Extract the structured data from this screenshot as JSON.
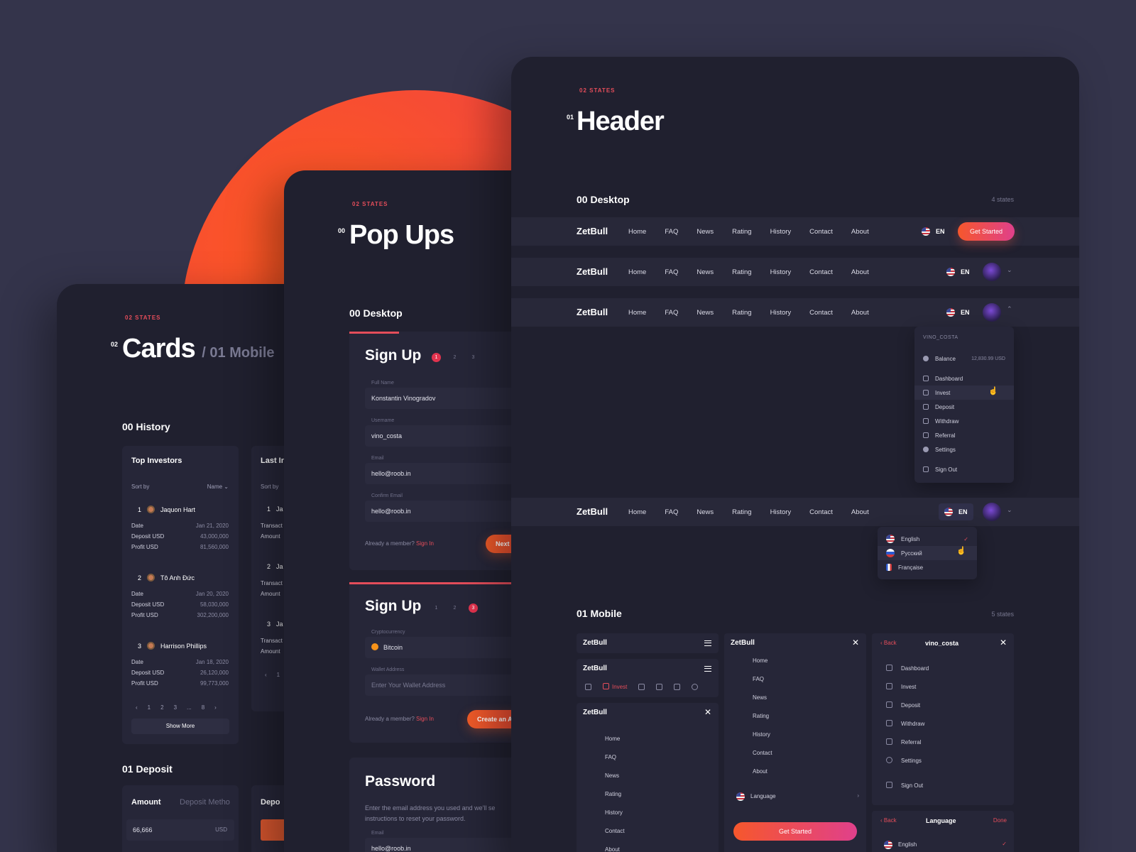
{
  "colors": {
    "background": "#34344b",
    "panel": "#20202f",
    "accent": "#e44d5a",
    "orange": "#f6572c",
    "pink": "#e0408b"
  },
  "cards_panel": {
    "states": "02 STATES",
    "num": "02",
    "title": "Cards",
    "subtitle": "/ 01 Mobile",
    "history_heading": "00 History",
    "top_investors": {
      "title": "Top Investors",
      "sort_label": "Sort by",
      "sort_value": "Name",
      "investors": [
        {
          "rank": "1",
          "name": "Jaquon Hart",
          "date": "Jan 21, 2020",
          "deposit": "43,000,000",
          "profit": "81,560,000"
        },
        {
          "rank": "2",
          "name": "Tô Anh Đức",
          "date": "Jan 20, 2020",
          "deposit": "58,030,000",
          "profit": "302,200,000"
        },
        {
          "rank": "3",
          "name": "Harrison Phillips",
          "date": "Jan 18, 2020",
          "deposit": "26,120,000",
          "profit": "99,773,000"
        }
      ],
      "labels": {
        "date": "Date",
        "deposit": "Deposit USD",
        "profit": "Profit USD"
      },
      "pagination": [
        "‹",
        "1",
        "2",
        "3",
        "...",
        "8",
        "›"
      ],
      "show_more": "Show More"
    },
    "last_card": {
      "title": "Last In",
      "sort_label": "Sort by",
      "rows": [
        {
          "rank": "1",
          "name": "Ja",
          "l1": "Transact",
          "l2": "Amount"
        },
        {
          "rank": "2",
          "name": "Ja",
          "l1": "Transact",
          "l2": "Amount"
        },
        {
          "rank": "3",
          "name": "Ja",
          "l1": "Transact",
          "l2": "Amount"
        }
      ],
      "pag": [
        "‹",
        "1"
      ]
    },
    "deposit_heading": "01 Deposit",
    "deposit_card": {
      "amount_label": "Amount",
      "method_label": "Deposit Metho",
      "amount_value": "66,666",
      "currency": "USD"
    },
    "deposit_card2": {
      "title": "Depo"
    }
  },
  "popups_panel": {
    "states": "02 STATES",
    "num": "00",
    "title": "Pop Ups",
    "desktop_heading": "00 Desktop",
    "signup1": {
      "title": "Sign Up",
      "steps": [
        "1",
        "2",
        "3"
      ],
      "fields": [
        {
          "label": "Full Name",
          "value": "Konstantin Vinogradov"
        },
        {
          "label": "Username",
          "value": "vino_costa"
        },
        {
          "label": "Email",
          "value": "hello@roob.in"
        },
        {
          "label": "Confirm Email",
          "value": "hello@roob.in"
        }
      ],
      "already": "Already a member?",
      "signin": "Sign In",
      "next": "Next"
    },
    "signup3": {
      "title": "Sign Up",
      "steps": [
        "1",
        "2",
        "3"
      ],
      "crypto_label": "Cryptocurrency",
      "crypto_value": "Bitcoin",
      "wallet_label": "Wallet Address",
      "wallet_placeholder": "Enter Your Wallet Address",
      "already": "Already a member?",
      "signin": "Sign In",
      "create": "Create an A"
    },
    "password": {
      "title": "Password",
      "desc": "Enter the email address you used and we'll se instructions to reset your password.",
      "email_label": "Email",
      "email_value": "hello@roob.in"
    }
  },
  "header_panel": {
    "states": "02 STATES",
    "num": "01",
    "title": "Header",
    "desktop_heading": "00 Desktop",
    "desktop_count": "4 states",
    "logo": "ZetBull",
    "links": [
      "Home",
      "FAQ",
      "News",
      "Rating",
      "History",
      "Contact",
      "About"
    ],
    "lang": "EN",
    "get_started": "Get Started",
    "user_menu": {
      "username": "VINO_COSTA",
      "balance_label": "Balance",
      "balance_value": "12,830.99 USD",
      "items": [
        "Dashboard",
        "Invest",
        "Deposit",
        "Withdraw",
        "Referral",
        "Settings"
      ],
      "sign_out": "Sign Out"
    },
    "lang_menu": [
      "English",
      "Русский",
      "Française"
    ],
    "mobile_heading": "01 Mobile",
    "mobile_count": "5 states",
    "mobile": {
      "logo": "ZetBull",
      "tab_invest": "Invest",
      "menu_links": [
        "Home",
        "FAQ",
        "News",
        "Rating",
        "History",
        "Contact",
        "About"
      ],
      "language": "Language",
      "get_started": "Get Started",
      "back": "Back",
      "user": "vino_costa",
      "user_items": [
        "Dashboard",
        "Invest",
        "Deposit",
        "Withdraw",
        "Referral",
        "Settings"
      ],
      "sign_out": "Sign Out",
      "lang_title": "Language",
      "done": "Done",
      "english": "English"
    }
  }
}
